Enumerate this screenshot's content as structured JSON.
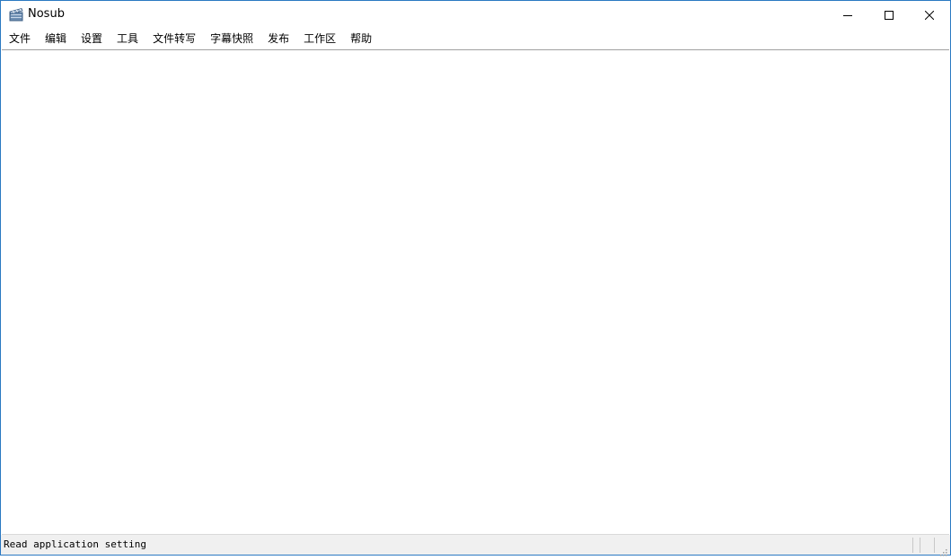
{
  "window": {
    "title": "Nosub",
    "app_icon": "clapperboard-icon",
    "controls": {
      "minimize_icon": "minimize-icon",
      "maximize_icon": "maximize-icon",
      "close_icon": "close-icon"
    }
  },
  "menubar": {
    "items": [
      {
        "label": "文件"
      },
      {
        "label": "编辑"
      },
      {
        "label": "设置"
      },
      {
        "label": "工具"
      },
      {
        "label": "文件转写"
      },
      {
        "label": "字幕快照"
      },
      {
        "label": "发布"
      },
      {
        "label": "工作区"
      },
      {
        "label": "帮助"
      }
    ]
  },
  "statusbar": {
    "message": "Read application setting",
    "grip_icon": "resize-grip-icon"
  },
  "colors": {
    "window_border": "#2b79c2",
    "statusbar_bg": "#f0f0f0",
    "content_bg": "#ffffff"
  }
}
